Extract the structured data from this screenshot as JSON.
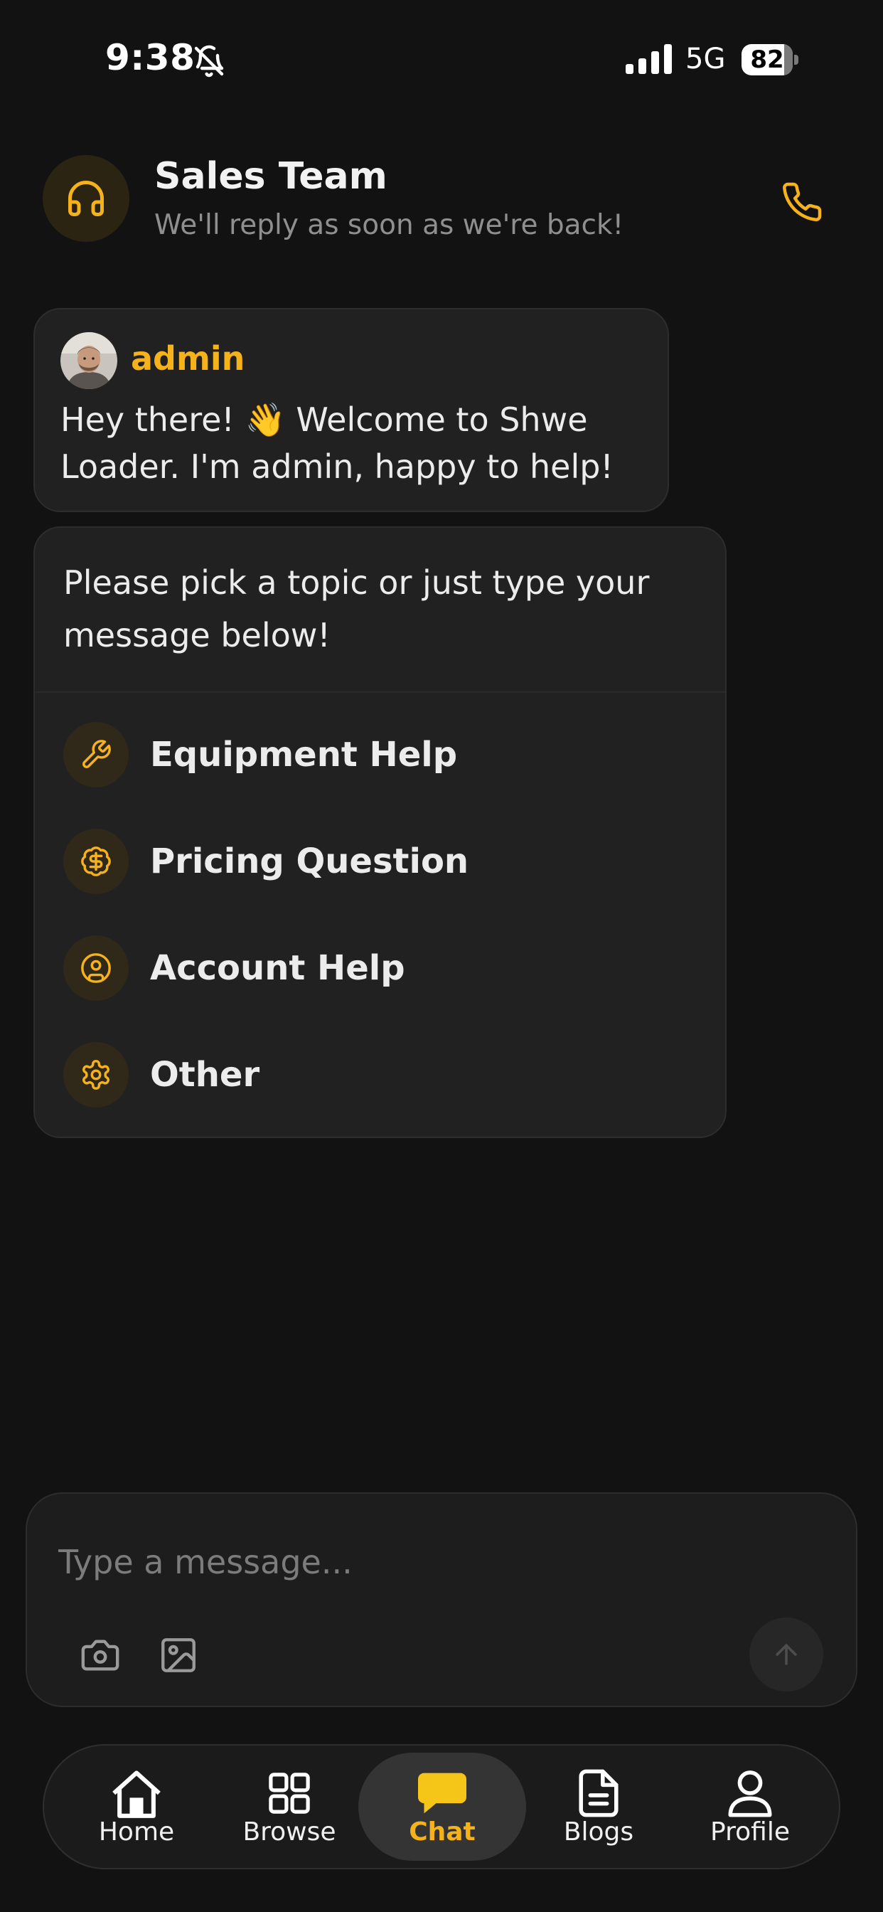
{
  "status_bar": {
    "time": "9:38",
    "network": "5G",
    "battery": "82",
    "battery_level_percent": 82,
    "icons": [
      "bell-slash-icon",
      "signal-icon",
      "battery-icon"
    ]
  },
  "header": {
    "title": "Sales Team",
    "subtitle": "We'll reply as soon as we're back!",
    "avatar_icon": "headset-icon",
    "action_icon": "phone-icon"
  },
  "messages": [
    {
      "sender": "admin",
      "text": "Hey there! 👋 Welcome to Shwe Loader. I'm admin, happy to help!"
    }
  ],
  "topic_card": {
    "prompt": "Please pick a topic or just type your message below!",
    "options": [
      {
        "label": "Equipment Help",
        "icon": "wrench-icon"
      },
      {
        "label": "Pricing Question",
        "icon": "dollar-badge-icon"
      },
      {
        "label": "Account Help",
        "icon": "user-circle-icon"
      },
      {
        "label": "Other",
        "icon": "gear-icon"
      }
    ]
  },
  "composer": {
    "placeholder": "Type a message...",
    "icons": [
      "camera-icon",
      "image-icon",
      "arrow-up-icon"
    ]
  },
  "nav": {
    "items": [
      {
        "label": "Home",
        "icon": "home-icon"
      },
      {
        "label": "Browse",
        "icon": "grid-icon"
      },
      {
        "label": "Chat",
        "icon": "chat-bubble-icon",
        "active": true
      },
      {
        "label": "Blogs",
        "icon": "document-icon"
      },
      {
        "label": "Profile",
        "icon": "user-icon"
      }
    ]
  },
  "colors": {
    "background": "#121212",
    "surface": "#212121",
    "accent": "#f5b21b",
    "text": "#ececec",
    "muted": "#8f8f8f"
  }
}
